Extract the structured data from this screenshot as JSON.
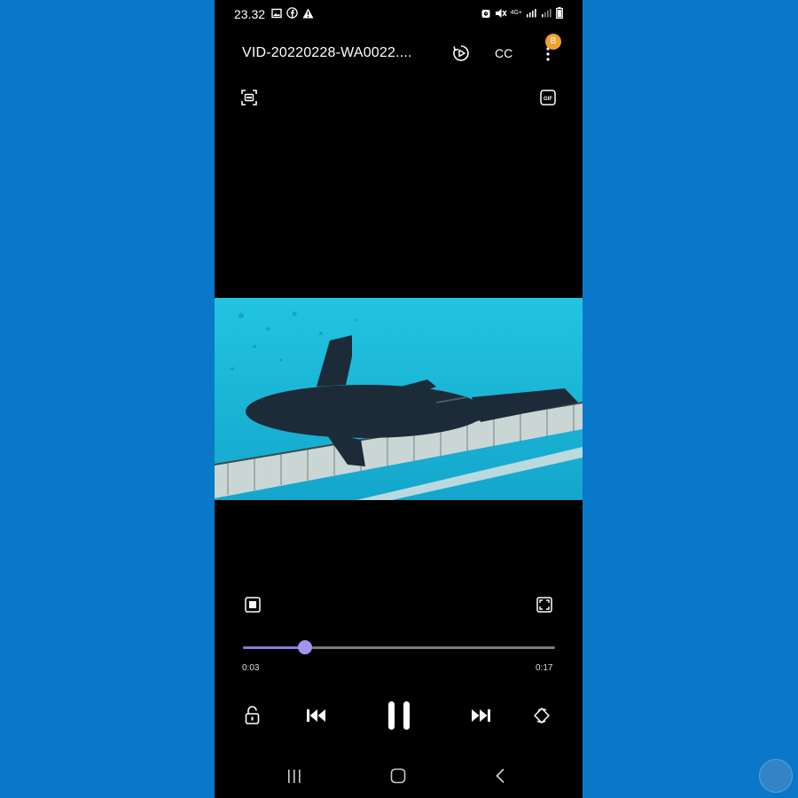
{
  "status_bar": {
    "time": "23.32",
    "network_label": "4G+"
  },
  "header": {
    "title": "VID-20220228-WA0022....",
    "cc_label": "CC",
    "badge_text": "B"
  },
  "player": {
    "current_time": "0:03",
    "total_time": "0:17",
    "progress": 0.2
  },
  "icons": {
    "capture": "screen-capture-icon",
    "gif": "gif-icon",
    "pip": "popup-player-icon",
    "ratio": "screen-ratio-icon",
    "lock": "lock-icon",
    "prev": "previous-icon",
    "pause": "pause-icon",
    "next": "next-icon",
    "rotate": "rotate-icon"
  },
  "colors": {
    "background": "#0a78c8",
    "seek_fill": "#8b7be0",
    "seek_thumb": "#a394f2",
    "badge": "#f0a030"
  }
}
